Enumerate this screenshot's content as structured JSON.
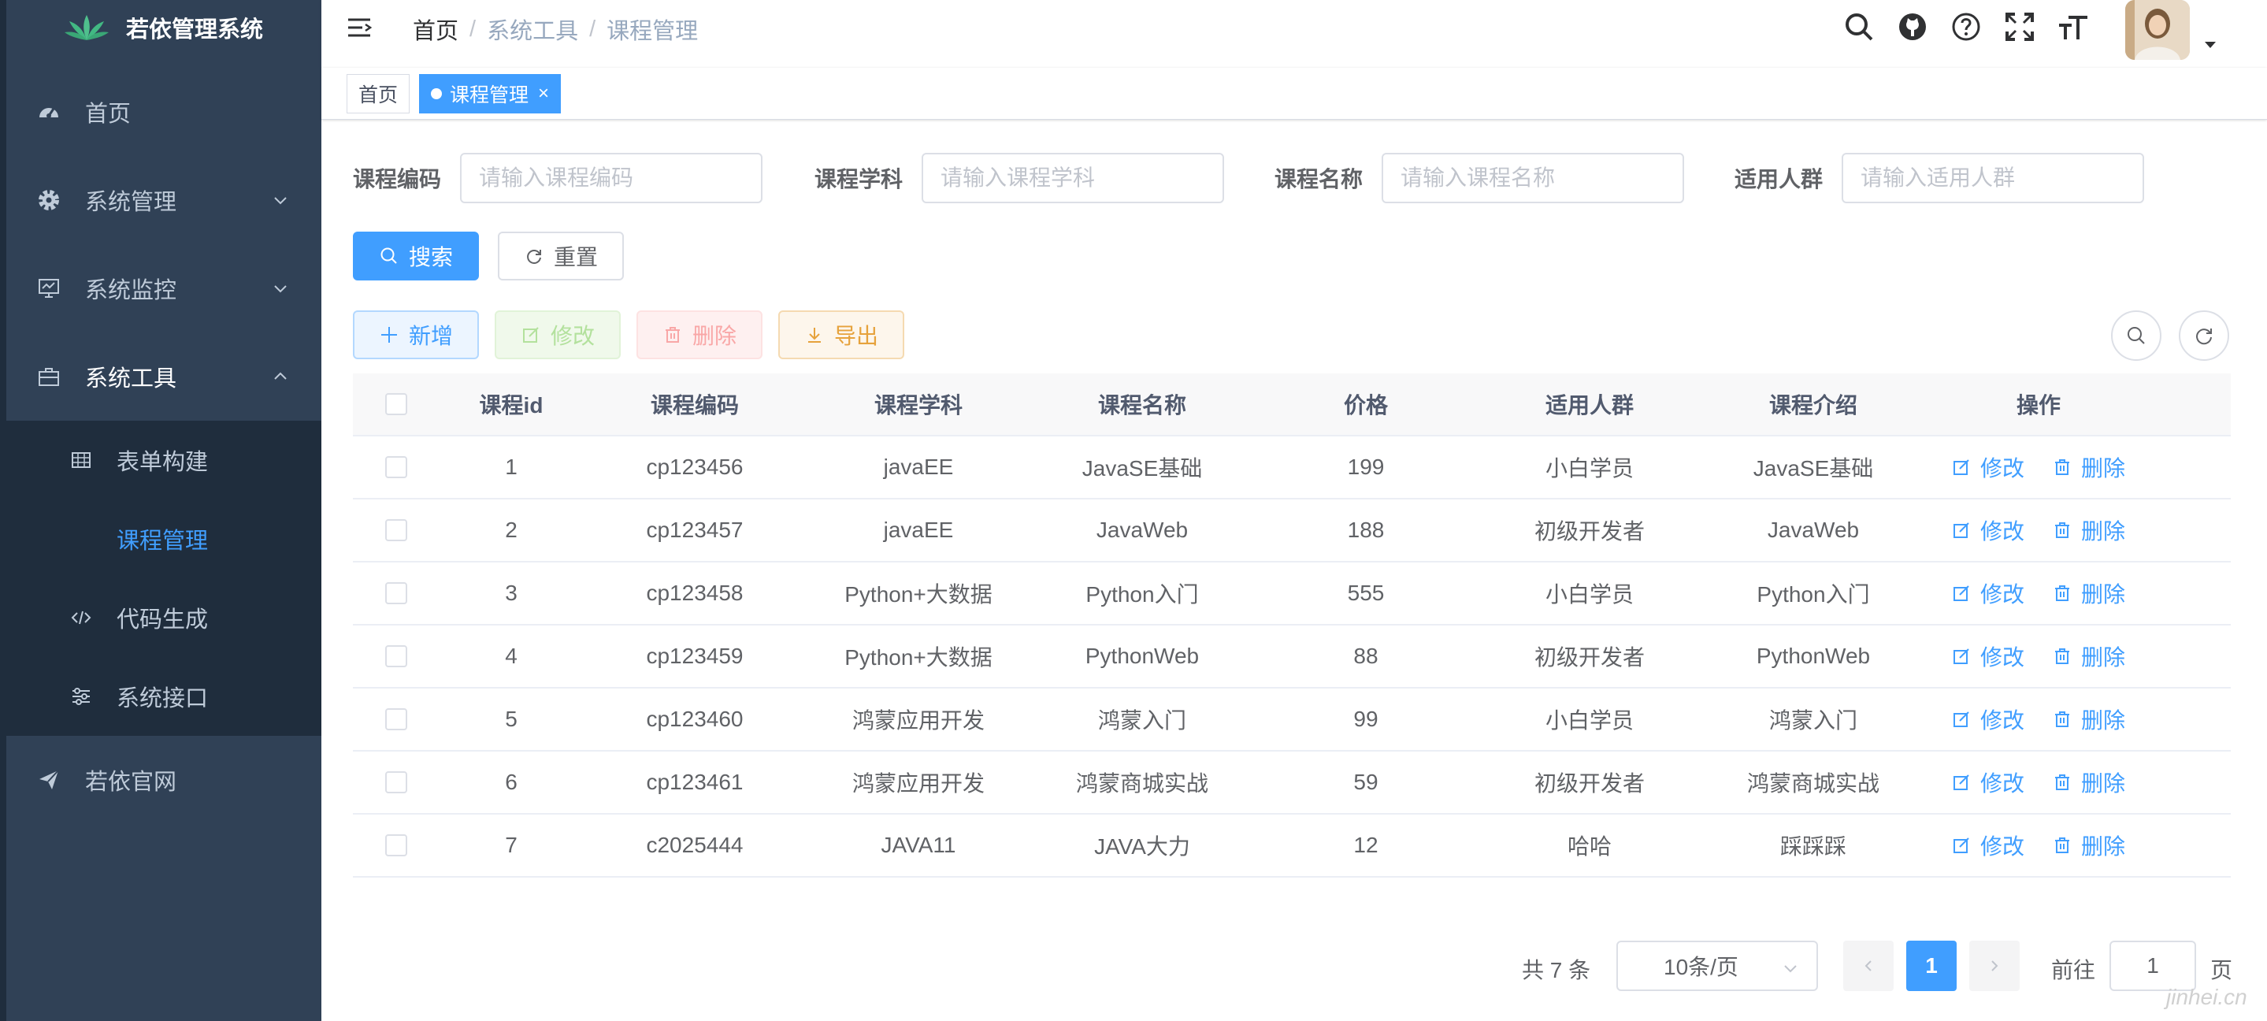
{
  "app": {
    "title": "若依管理系统"
  },
  "sidebar": {
    "items": [
      {
        "label": "首页",
        "icon": "dashboard-icon"
      },
      {
        "label": "系统管理",
        "icon": "gear-icon"
      },
      {
        "label": "系统监控",
        "icon": "monitor-icon"
      },
      {
        "label": "系统工具",
        "icon": "toolbox-icon"
      },
      {
        "label": "若依官网",
        "icon": "send-icon"
      }
    ],
    "sub_items": [
      {
        "label": "表单构建",
        "icon": "table-icon"
      },
      {
        "label": "课程管理"
      },
      {
        "label": "代码生成",
        "icon": "code-icon"
      },
      {
        "label": "系统接口",
        "icon": "sliders-icon"
      }
    ]
  },
  "breadcrumb": {
    "home": "首页",
    "level1": "系统工具",
    "level2": "课程管理"
  },
  "tags": {
    "home": "首页",
    "active": "课程管理"
  },
  "search_form": {
    "code_label": "课程编码",
    "code_placeholder": "请输入课程编码",
    "subject_label": "课程学科",
    "subject_placeholder": "请输入课程学科",
    "name_label": "课程名称",
    "name_placeholder": "请输入课程名称",
    "audience_label": "适用人群",
    "audience_placeholder": "请输入适用人群",
    "search_button": "搜索",
    "reset_button": "重置"
  },
  "toolbar": {
    "add": "新增",
    "edit": "修改",
    "delete": "删除",
    "export": "导出"
  },
  "table": {
    "headers": [
      "课程id",
      "课程编码",
      "课程学科",
      "课程名称",
      "价格",
      "适用人群",
      "课程介绍",
      "操作"
    ],
    "rows": [
      [
        "1",
        "cp123456",
        "javaEE",
        "JavaSE基础",
        "199",
        "小白学员",
        "JavaSE基础"
      ],
      [
        "2",
        "cp123457",
        "javaEE",
        "JavaWeb",
        "188",
        "初级开发者",
        "JavaWeb"
      ],
      [
        "3",
        "cp123458",
        "Python+大数据",
        "Python入门",
        "555",
        "小白学员",
        "Python入门"
      ],
      [
        "4",
        "cp123459",
        "Python+大数据",
        "PythonWeb",
        "88",
        "初级开发者",
        "PythonWeb"
      ],
      [
        "5",
        "cp123460",
        "鸿蒙应用开发",
        "鸿蒙入门",
        "99",
        "小白学员",
        "鸿蒙入门"
      ],
      [
        "6",
        "cp123461",
        "鸿蒙应用开发",
        "鸿蒙商城实战",
        "59",
        "初级开发者",
        "鸿蒙商城实战"
      ],
      [
        "7",
        "c2025444",
        "JAVA11",
        "JAVA大力",
        "12",
        "哈哈",
        "踩踩踩"
      ]
    ],
    "row_edit": "修改",
    "row_delete": "删除"
  },
  "pagination": {
    "total": "共 7 条",
    "page_size": "10条/页",
    "current_page": "1",
    "goto_prefix": "前往",
    "goto_value": "1",
    "goto_suffix": "页"
  },
  "watermark": "jinhei.cn",
  "colors": {
    "sidebar_bg": "#304156",
    "submenu_bg": "#1f2d3d",
    "primary": "#409eff",
    "warning": "#e6a23c"
  }
}
